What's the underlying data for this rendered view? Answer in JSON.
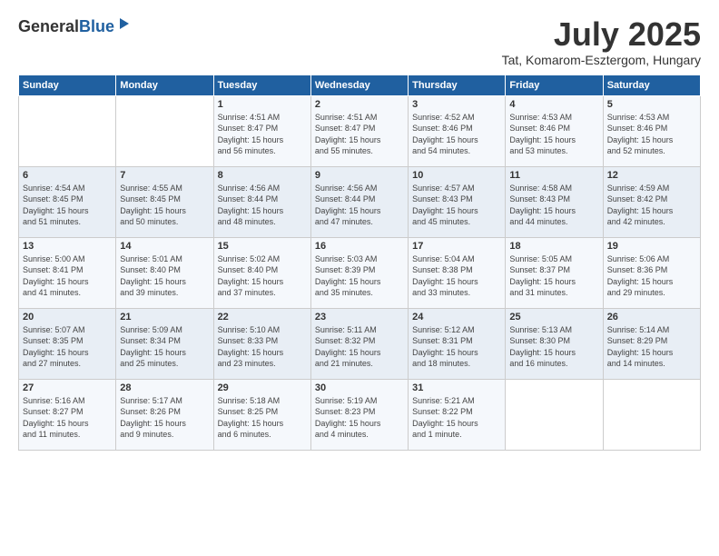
{
  "logo": {
    "general": "General",
    "blue": "Blue"
  },
  "header": {
    "month": "July 2025",
    "location": "Tat, Komarom-Esztergom, Hungary"
  },
  "weekdays": [
    "Sunday",
    "Monday",
    "Tuesday",
    "Wednesday",
    "Thursday",
    "Friday",
    "Saturday"
  ],
  "weeks": [
    [
      {
        "day": "",
        "info": ""
      },
      {
        "day": "",
        "info": ""
      },
      {
        "day": "1",
        "info": "Sunrise: 4:51 AM\nSunset: 8:47 PM\nDaylight: 15 hours\nand 56 minutes."
      },
      {
        "day": "2",
        "info": "Sunrise: 4:51 AM\nSunset: 8:47 PM\nDaylight: 15 hours\nand 55 minutes."
      },
      {
        "day": "3",
        "info": "Sunrise: 4:52 AM\nSunset: 8:46 PM\nDaylight: 15 hours\nand 54 minutes."
      },
      {
        "day": "4",
        "info": "Sunrise: 4:53 AM\nSunset: 8:46 PM\nDaylight: 15 hours\nand 53 minutes."
      },
      {
        "day": "5",
        "info": "Sunrise: 4:53 AM\nSunset: 8:46 PM\nDaylight: 15 hours\nand 52 minutes."
      }
    ],
    [
      {
        "day": "6",
        "info": "Sunrise: 4:54 AM\nSunset: 8:45 PM\nDaylight: 15 hours\nand 51 minutes."
      },
      {
        "day": "7",
        "info": "Sunrise: 4:55 AM\nSunset: 8:45 PM\nDaylight: 15 hours\nand 50 minutes."
      },
      {
        "day": "8",
        "info": "Sunrise: 4:56 AM\nSunset: 8:44 PM\nDaylight: 15 hours\nand 48 minutes."
      },
      {
        "day": "9",
        "info": "Sunrise: 4:56 AM\nSunset: 8:44 PM\nDaylight: 15 hours\nand 47 minutes."
      },
      {
        "day": "10",
        "info": "Sunrise: 4:57 AM\nSunset: 8:43 PM\nDaylight: 15 hours\nand 45 minutes."
      },
      {
        "day": "11",
        "info": "Sunrise: 4:58 AM\nSunset: 8:43 PM\nDaylight: 15 hours\nand 44 minutes."
      },
      {
        "day": "12",
        "info": "Sunrise: 4:59 AM\nSunset: 8:42 PM\nDaylight: 15 hours\nand 42 minutes."
      }
    ],
    [
      {
        "day": "13",
        "info": "Sunrise: 5:00 AM\nSunset: 8:41 PM\nDaylight: 15 hours\nand 41 minutes."
      },
      {
        "day": "14",
        "info": "Sunrise: 5:01 AM\nSunset: 8:40 PM\nDaylight: 15 hours\nand 39 minutes."
      },
      {
        "day": "15",
        "info": "Sunrise: 5:02 AM\nSunset: 8:40 PM\nDaylight: 15 hours\nand 37 minutes."
      },
      {
        "day": "16",
        "info": "Sunrise: 5:03 AM\nSunset: 8:39 PM\nDaylight: 15 hours\nand 35 minutes."
      },
      {
        "day": "17",
        "info": "Sunrise: 5:04 AM\nSunset: 8:38 PM\nDaylight: 15 hours\nand 33 minutes."
      },
      {
        "day": "18",
        "info": "Sunrise: 5:05 AM\nSunset: 8:37 PM\nDaylight: 15 hours\nand 31 minutes."
      },
      {
        "day": "19",
        "info": "Sunrise: 5:06 AM\nSunset: 8:36 PM\nDaylight: 15 hours\nand 29 minutes."
      }
    ],
    [
      {
        "day": "20",
        "info": "Sunrise: 5:07 AM\nSunset: 8:35 PM\nDaylight: 15 hours\nand 27 minutes."
      },
      {
        "day": "21",
        "info": "Sunrise: 5:09 AM\nSunset: 8:34 PM\nDaylight: 15 hours\nand 25 minutes."
      },
      {
        "day": "22",
        "info": "Sunrise: 5:10 AM\nSunset: 8:33 PM\nDaylight: 15 hours\nand 23 minutes."
      },
      {
        "day": "23",
        "info": "Sunrise: 5:11 AM\nSunset: 8:32 PM\nDaylight: 15 hours\nand 21 minutes."
      },
      {
        "day": "24",
        "info": "Sunrise: 5:12 AM\nSunset: 8:31 PM\nDaylight: 15 hours\nand 18 minutes."
      },
      {
        "day": "25",
        "info": "Sunrise: 5:13 AM\nSunset: 8:30 PM\nDaylight: 15 hours\nand 16 minutes."
      },
      {
        "day": "26",
        "info": "Sunrise: 5:14 AM\nSunset: 8:29 PM\nDaylight: 15 hours\nand 14 minutes."
      }
    ],
    [
      {
        "day": "27",
        "info": "Sunrise: 5:16 AM\nSunset: 8:27 PM\nDaylight: 15 hours\nand 11 minutes."
      },
      {
        "day": "28",
        "info": "Sunrise: 5:17 AM\nSunset: 8:26 PM\nDaylight: 15 hours\nand 9 minutes."
      },
      {
        "day": "29",
        "info": "Sunrise: 5:18 AM\nSunset: 8:25 PM\nDaylight: 15 hours\nand 6 minutes."
      },
      {
        "day": "30",
        "info": "Sunrise: 5:19 AM\nSunset: 8:23 PM\nDaylight: 15 hours\nand 4 minutes."
      },
      {
        "day": "31",
        "info": "Sunrise: 5:21 AM\nSunset: 8:22 PM\nDaylight: 15 hours\nand 1 minute."
      },
      {
        "day": "",
        "info": ""
      },
      {
        "day": "",
        "info": ""
      }
    ]
  ]
}
